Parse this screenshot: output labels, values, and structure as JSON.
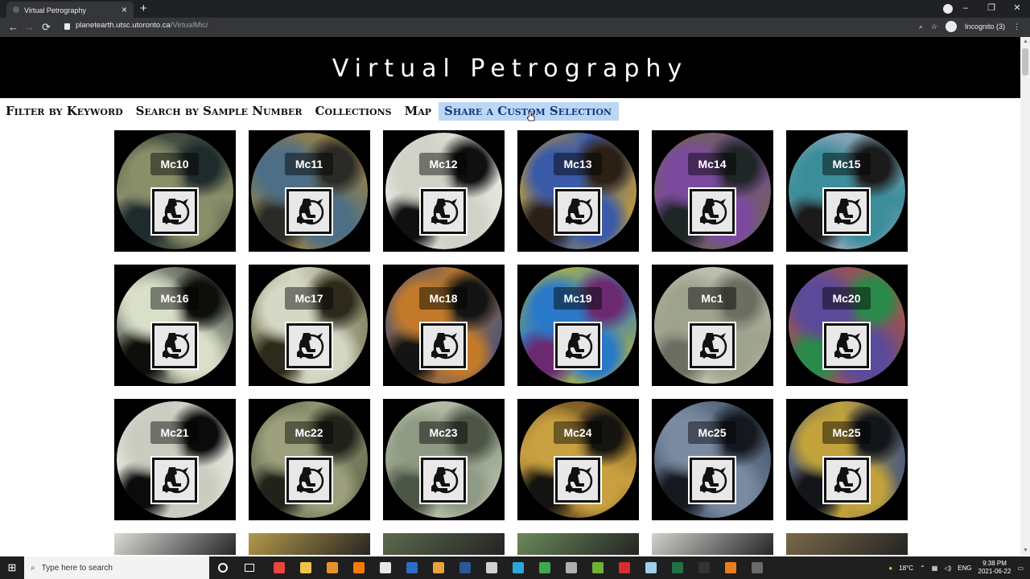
{
  "browser": {
    "tab_title": "Virtual Petrography",
    "url_host": "planetearth.utsc.utoronto.ca",
    "url_path": "/VirtualMic/",
    "profile_label": "Incognito (3)"
  },
  "page": {
    "title": "Virtual Petrography",
    "nav": [
      {
        "label": "Filter by Keyword"
      },
      {
        "label": "Search by Sample Number"
      },
      {
        "label": "Collections"
      },
      {
        "label": "Map"
      },
      {
        "label": "Share a Custom Selection"
      }
    ],
    "samples": [
      {
        "label": "Mc10",
        "c1": "#3f4a3e",
        "c2": "#8a8f6a",
        "c3": "#1f2a2c"
      },
      {
        "label": "Mc11",
        "c1": "#b88a2c",
        "c2": "#4d6e86",
        "c3": "#2a2a26"
      },
      {
        "label": "Mc12",
        "c1": "#e9ebe3",
        "c2": "#cfd2c6",
        "c3": "#101010"
      },
      {
        "label": "Mc13",
        "c1": "#d9a524",
        "c2": "#3a5aa8",
        "c3": "#2b1f16"
      },
      {
        "label": "Mc14",
        "c1": "#6a6a3a",
        "c2": "#7b4aa0",
        "c3": "#1e2626"
      },
      {
        "label": "Mc15",
        "c1": "#8fa7b8",
        "c2": "#3c8d9a",
        "c3": "#1a1a1a"
      },
      {
        "label": "Mc16",
        "c1": "#20261f",
        "c2": "#d9dfc8",
        "c3": "#0d0f0b"
      },
      {
        "label": "Mc17",
        "c1": "#7b7a58",
        "c2": "#d6d8c6",
        "c3": "#2d2a1c"
      },
      {
        "label": "Mc18",
        "c1": "#304a8a",
        "c2": "#c27a2a",
        "c3": "#141414"
      },
      {
        "label": "Mc19",
        "c1": "#d8c21c",
        "c2": "#2a79c8",
        "c3": "#6b2a70"
      },
      {
        "label": "Mc1",
        "c1": "#c2c6b6",
        "c2": "#9ea38e",
        "c3": "#6b6e60"
      },
      {
        "label": "Mc20",
        "c1": "#c25a22",
        "c2": "#5a4a9a",
        "c3": "#2a8a4a"
      },
      {
        "label": "Mc21",
        "c1": "#e3e5dc",
        "c2": "#c9ccbf",
        "c3": "#0b0b0b"
      },
      {
        "label": "Mc22",
        "c1": "#5a6046",
        "c2": "#9da07c",
        "c3": "#20231a"
      },
      {
        "label": "Mc23",
        "c1": "#c5ccb8",
        "c2": "#8f9a84",
        "c3": "#4c5546"
      },
      {
        "label": "Mc24",
        "c1": "#6a4a20",
        "c2": "#c8a040",
        "c3": "#141410"
      },
      {
        "label": "Mc25",
        "c1": "#3a4a5e",
        "c2": "#7a8aa0",
        "c3": "#15191f"
      },
      {
        "label": "Mc25",
        "c1": "#4a5a7a",
        "c2": "#c2a23a",
        "c3": "#12151a"
      }
    ],
    "row4_colors": [
      "#d9dcd6",
      "#b59a4a",
      "#5c6a4e",
      "#6a8a5a",
      "#cfd2cc",
      "#7a6a4a"
    ]
  },
  "taskbar": {
    "search_placeholder": "Type here to search",
    "weather": "18°C",
    "lang": "ENG",
    "time": "9:38 PM",
    "date": "2021-06-22",
    "apps": [
      "#e8453c",
      "#f0c24a",
      "#e8912c",
      "#f57c00",
      "#e7e7e7",
      "#2d6cc4",
      "#e8a33c",
      "#2b579a",
      "#d0d0d0",
      "#2ca8d8",
      "#3fa84c",
      "#b0b0b0",
      "#6fb23a",
      "#d32f2f",
      "#9ecfe8",
      "#1f7244",
      "#333333",
      "#e67e22",
      "#6a6a6a"
    ]
  }
}
